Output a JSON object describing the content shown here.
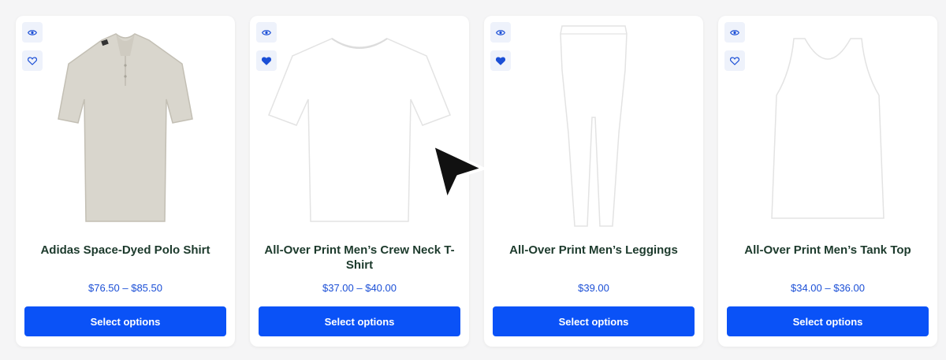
{
  "colors": {
    "page_bg": "#f5f5f6",
    "button_bg": "#0a52f7",
    "price": "#1b4fd6",
    "title": "#1c3a2c",
    "icon": "#1b4fd6"
  },
  "products": [
    {
      "title": "Adidas Space-Dyed Polo Shirt",
      "price": "$76.50 – $85.50",
      "button": "Select options",
      "image_icon": "polo-shirt-image",
      "wishlisted": false
    },
    {
      "title": "All-Over Print Men’s Crew Neck T-Shirt",
      "price": "$37.00 – $40.00",
      "button": "Select options",
      "image_icon": "tshirt-image",
      "wishlisted": true
    },
    {
      "title": "All-Over Print Men’s Leggings",
      "price": "$39.00",
      "button": "Select options",
      "image_icon": "leggings-image",
      "wishlisted": true
    },
    {
      "title": "All-Over Print Men’s Tank Top",
      "price": "$34.00 – $36.00",
      "button": "Select options",
      "image_icon": "tank-top-image",
      "wishlisted": false
    }
  ]
}
